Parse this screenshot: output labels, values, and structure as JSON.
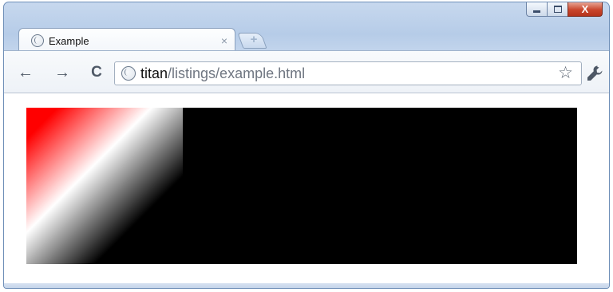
{
  "window": {
    "controls": {
      "minimize": "minimize-icon",
      "maximize": "maximize-icon",
      "close_label": "X"
    }
  },
  "tab": {
    "title": "Example",
    "close_label": "×",
    "icon": "globe-icon"
  },
  "new_tab": {
    "icon": "plus-icon",
    "label": "+"
  },
  "toolbar": {
    "back_label": "←",
    "forward_label": "→",
    "reload_label": "C",
    "bookmark_label": "☆"
  },
  "omnibox": {
    "url_host": "titan",
    "url_path": "/listings/example.html",
    "icon": "globe-icon"
  },
  "colors": {
    "gradient_start": "#ff0000",
    "gradient_mid": "#ffffff",
    "gradient_end": "#000000",
    "canvas_background": "#000000"
  }
}
